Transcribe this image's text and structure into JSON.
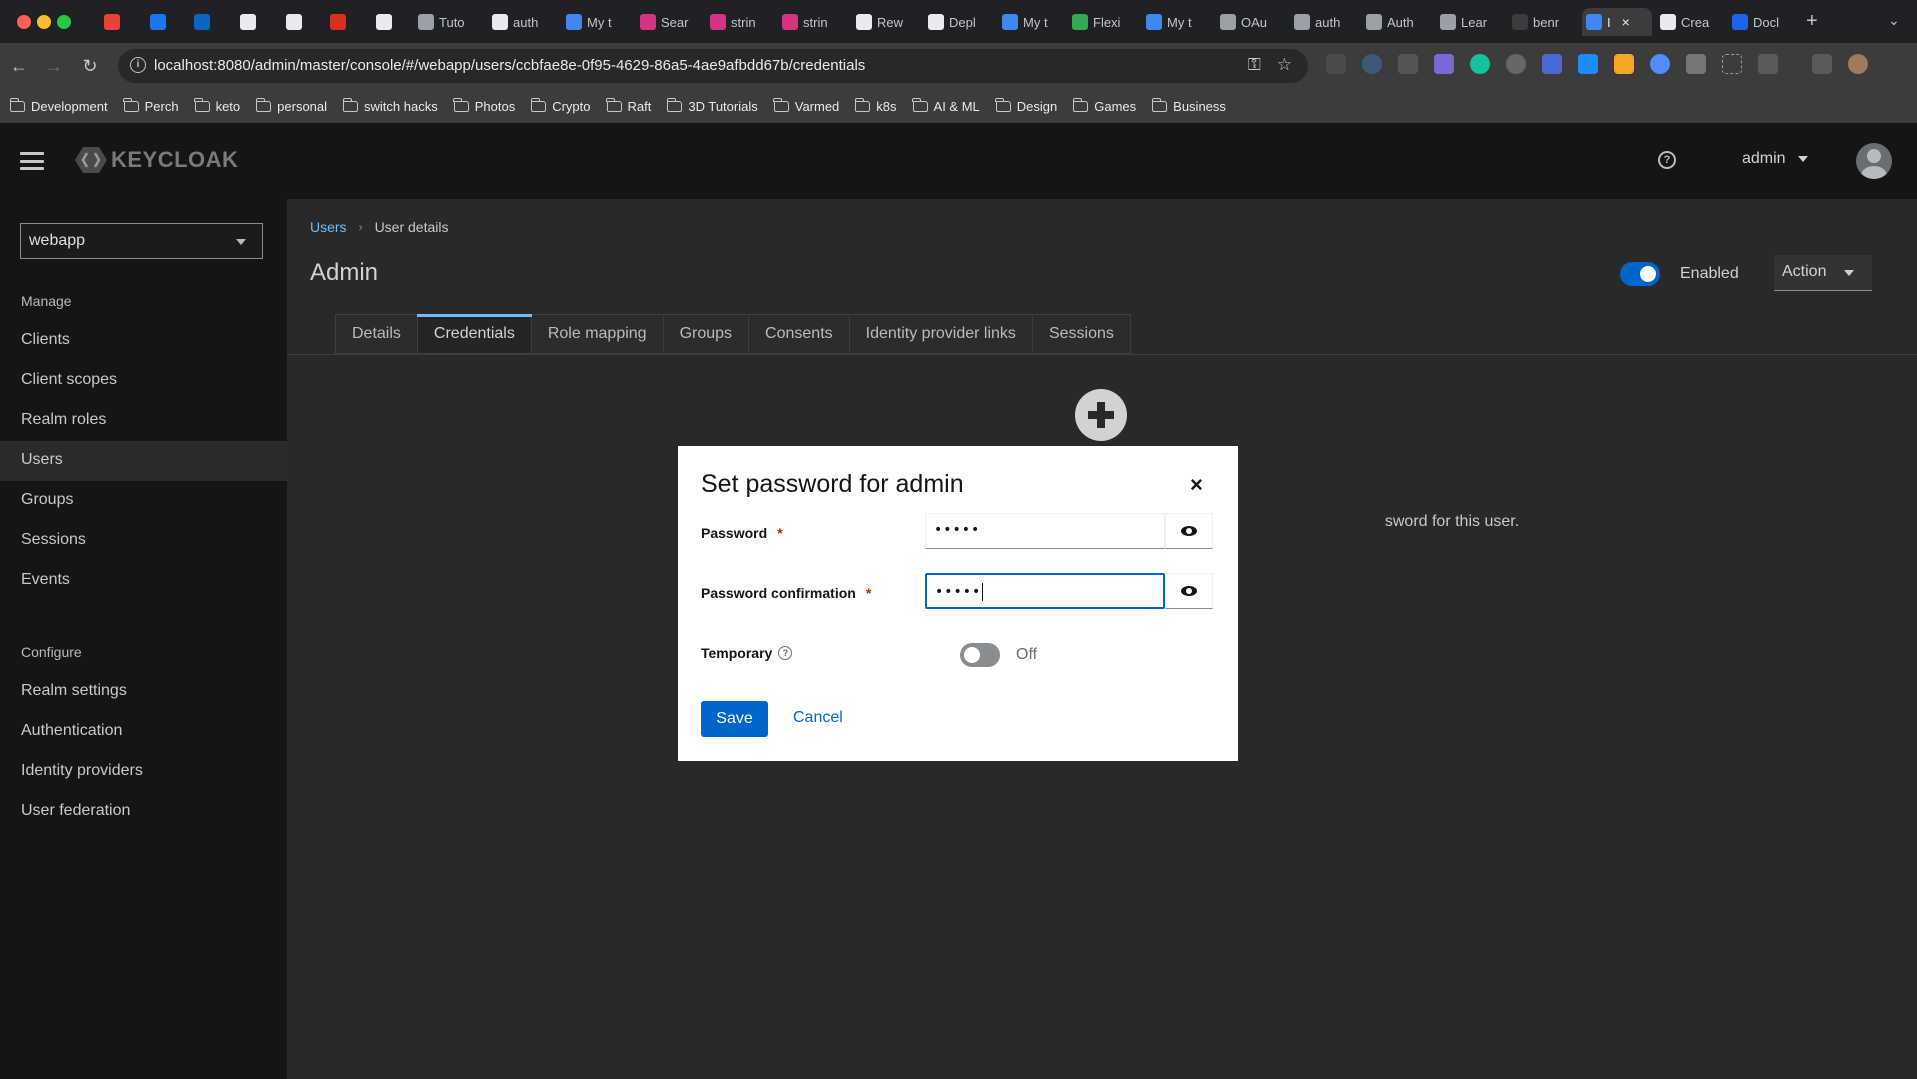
{
  "browser": {
    "tabs": [
      {
        "label": "",
        "icon": "gmail-icon",
        "color": "#ea4335"
      },
      {
        "label": "",
        "icon": "facebook-icon",
        "color": "#1877f2"
      },
      {
        "label": "",
        "icon": "linkedin-icon",
        "color": "#0a66c2"
      },
      {
        "label": "",
        "icon": "threads-icon",
        "color": "#e8eaed"
      },
      {
        "label": "",
        "icon": "x-icon",
        "color": "#e8eaed"
      },
      {
        "label": "",
        "icon": "badge-icon",
        "color": "#d93025"
      },
      {
        "label": "",
        "icon": "github-icon",
        "color": "#e8eaed"
      },
      {
        "label": "Tuto",
        "icon": "openai-icon",
        "color": "#9aa0a6"
      },
      {
        "label": "auth",
        "icon": "github-icon",
        "color": "#e8eaed"
      },
      {
        "label": "My t",
        "icon": "stripe-icon",
        "color": "#4285f4"
      },
      {
        "label": "Sear",
        "icon": "hashnode-icon",
        "color": "#d63384"
      },
      {
        "label": "strin",
        "icon": "hashnode-icon",
        "color": "#d63384"
      },
      {
        "label": "strin",
        "icon": "hashnode-icon",
        "color": "#d63384"
      },
      {
        "label": "Rew",
        "icon": "github-icon",
        "color": "#e8eaed"
      },
      {
        "label": "Depl",
        "icon": "github-icon",
        "color": "#e8eaed"
      },
      {
        "label": "My t",
        "icon": "stripe-icon",
        "color": "#4285f4"
      },
      {
        "label": "Flexi",
        "icon": "leaf-icon",
        "color": "#34a853"
      },
      {
        "label": "My t",
        "icon": "stripe-icon",
        "color": "#4285f4"
      },
      {
        "label": "OAu",
        "icon": "openai-icon",
        "color": "#9aa0a6"
      },
      {
        "label": "auth",
        "icon": "openai-icon",
        "color": "#9aa0a6"
      },
      {
        "label": "Auth",
        "icon": "openai-icon",
        "color": "#9aa0a6"
      },
      {
        "label": "Lear",
        "icon": "k-icon",
        "color": "#9aa0a6"
      },
      {
        "label": "benr",
        "icon": "circle-icon",
        "color": "#3c3c3c"
      },
      {
        "label": "I",
        "icon": "keycloak-icon",
        "color": "#4285f4"
      },
      {
        "label": "Crea",
        "icon": "triangle-icon",
        "color": "#e8eaed"
      },
      {
        "label": "Docl",
        "icon": "docker-icon",
        "color": "#1d63ed"
      }
    ],
    "active_tab_close": "×",
    "new_tab": "+",
    "url": "localhost:8080/admin/master/console/#/webapp/users/ccbfae8e-0f95-4629-86a5-4ae9afbdd67b/credentials",
    "bookmarks": [
      "Development",
      "Perch",
      "keto",
      "personal",
      "switch hacks",
      "Photos",
      "Crypto",
      "Raft",
      "3D Tutorials",
      "Varmed",
      "k8s",
      "AI & ML",
      "Design",
      "Games",
      "Business"
    ]
  },
  "header": {
    "logo_text": "KEYCLOAK",
    "username": "admin"
  },
  "sidebar": {
    "realm": "webapp",
    "manage_label": "Manage",
    "manage_items": [
      "Clients",
      "Client scopes",
      "Realm roles",
      "Users",
      "Groups",
      "Sessions",
      "Events"
    ],
    "configure_label": "Configure",
    "configure_items": [
      "Realm settings",
      "Authentication",
      "Identity providers",
      "User federation"
    ],
    "current": "Users"
  },
  "main": {
    "breadcrumb": {
      "link": "Users",
      "current": "User details"
    },
    "title": "Admin",
    "enabled_label": "Enabled",
    "enabled": true,
    "action_label": "Action",
    "tabs": [
      "Details",
      "Credentials",
      "Role mapping",
      "Groups",
      "Consents",
      "Identity provider links",
      "Sessions"
    ],
    "active_tab": "Credentials",
    "empty_text_visible": "sword for this user."
  },
  "modal": {
    "title": "Set password for admin",
    "close": "×",
    "password_label": "Password",
    "password_value": "•••••",
    "confirm_label": "Password confirmation",
    "confirm_value": "•••••",
    "required_mark": "*",
    "temporary_label": "Temporary",
    "temporary_state": "Off",
    "temporary_on": false,
    "save_label": "Save",
    "cancel_label": "Cancel"
  },
  "colors": {
    "accent": "#0066cc",
    "link": "#73bcf7",
    "required": "#c9190b",
    "toggle_on": "#0066cc",
    "toggle_off": "#8a8d90"
  }
}
